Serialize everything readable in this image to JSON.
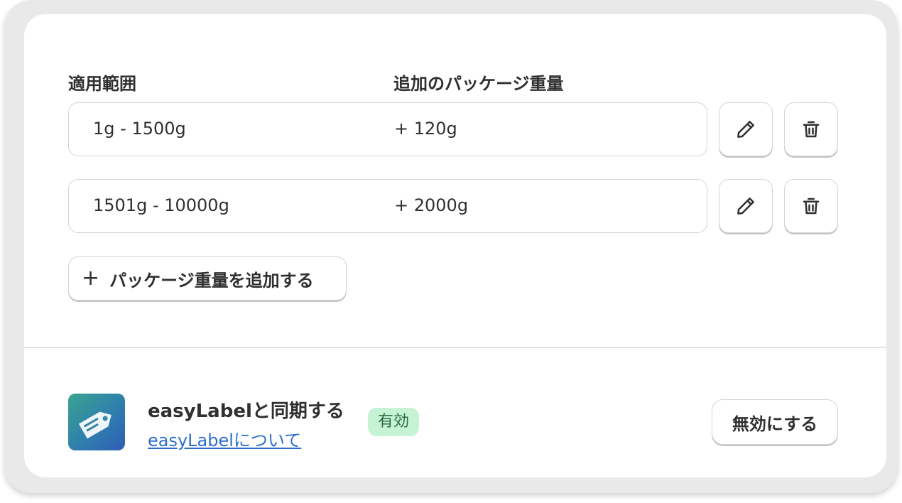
{
  "headers": {
    "range": "適用範囲",
    "weight": "追加のパッケージ重量"
  },
  "rows": [
    {
      "range": "1g - 1500g",
      "weight": "+ 120g"
    },
    {
      "range": "1501g - 10000g",
      "weight": "+ 2000g"
    }
  ],
  "add_button": {
    "icon": "+",
    "label": "パッケージ重量を追加する"
  },
  "integration": {
    "title": "easyLabelと同期する",
    "link": "easyLabelについて",
    "status": "有効",
    "toggle_button": "無効にする",
    "logo_icon": "tag-icon"
  },
  "colors": {
    "link": "#2c6ecb",
    "badge_bg": "#c6f3d3",
    "badge_text": "#2f6b43",
    "logo_gradient_start": "#3aa58f",
    "logo_gradient_end": "#2f5db5"
  }
}
